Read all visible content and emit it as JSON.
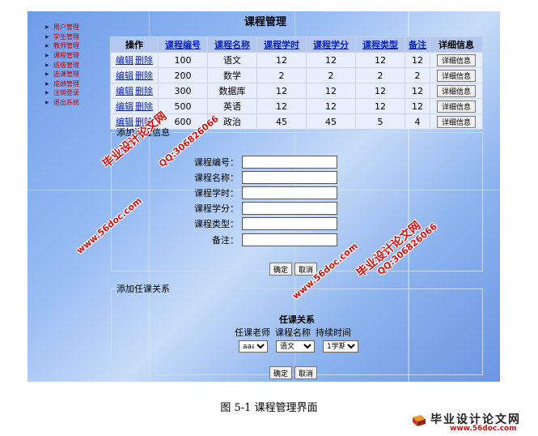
{
  "title": "课程管理",
  "sidebar": {
    "items": [
      {
        "label": "用户管理"
      },
      {
        "label": "学生管理"
      },
      {
        "label": "教师管理"
      },
      {
        "label": "课程管理"
      },
      {
        "label": "班级管理"
      },
      {
        "label": "选课管理"
      },
      {
        "label": "成绩管理"
      },
      {
        "label": "注销登录"
      },
      {
        "label": "退出系统"
      }
    ]
  },
  "table": {
    "headers": [
      "操作",
      "课程编号",
      "课程名称",
      "课程学时",
      "课程学分",
      "课程类型",
      "备注",
      "详细信息"
    ],
    "edit_label": "编辑",
    "delete_label": "删除",
    "detail_label": "详细信息",
    "rows": [
      {
        "id": "100",
        "name": "语文",
        "hours": "12",
        "credits": "12",
        "type": "12",
        "note": "12"
      },
      {
        "id": "200",
        "name": "数学",
        "hours": "2",
        "credits": "2",
        "type": "2",
        "note": "2"
      },
      {
        "id": "300",
        "name": "数据库",
        "hours": "12",
        "credits": "12",
        "type": "12",
        "note": "12"
      },
      {
        "id": "500",
        "name": "英语",
        "hours": "12",
        "credits": "12",
        "type": "12",
        "note": "12"
      },
      {
        "id": "600",
        "name": "政治",
        "hours": "45",
        "credits": "45",
        "type": "5",
        "note": "4"
      }
    ]
  },
  "add_course": {
    "legend": "添加课程信息",
    "fields": [
      {
        "label": "课程编号：",
        "value": ""
      },
      {
        "label": "课程名称：",
        "value": ""
      },
      {
        "label": "课程学时：",
        "value": ""
      },
      {
        "label": "课程学分：",
        "value": ""
      },
      {
        "label": "课程类型：",
        "value": ""
      },
      {
        "label": "备注：",
        "value": ""
      }
    ],
    "confirm": "确定",
    "cancel": "取消"
  },
  "add_relation": {
    "legend": "添加任课关系",
    "title": "任课关系",
    "headers": [
      "任课老师",
      "课程名称",
      "持续时间"
    ],
    "teacher_selected": "aaa",
    "course_selected": "语文",
    "duration_selected": "1学期",
    "confirm": "确定",
    "cancel": "取消"
  },
  "watermarks": {
    "site_cn": "毕业设计论文网",
    "url": "www.56doc.com",
    "qq": "QQ:306826066"
  },
  "caption": "图 5-1  课程管理界面",
  "brand": {
    "name": "毕业设计论文网",
    "url": "www.56doc.com"
  }
}
